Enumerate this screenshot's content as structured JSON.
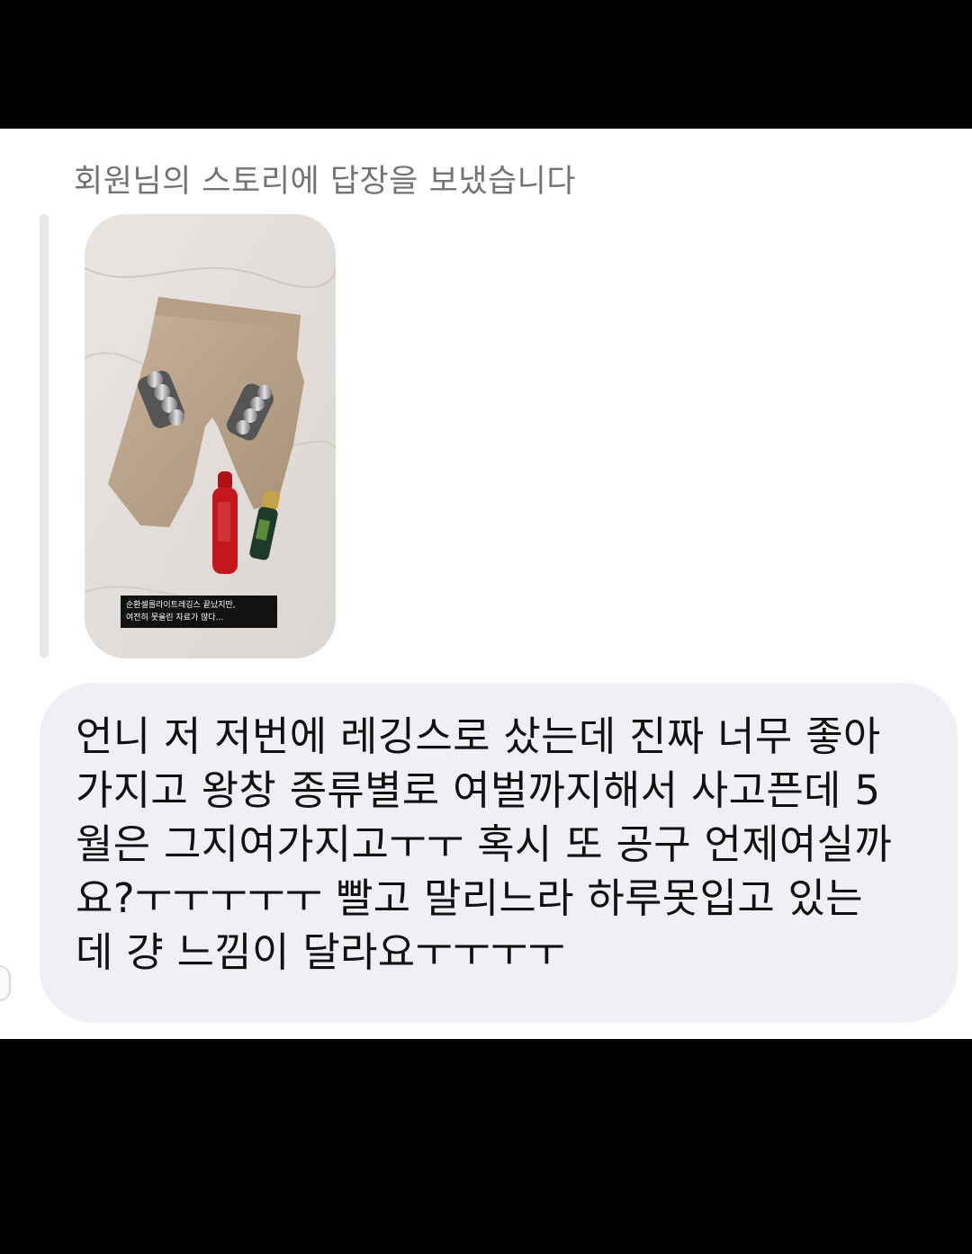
{
  "thread": {
    "story_reply_caption": "회원님의 스토리에 답장을 보냈습니다",
    "story": {
      "caption_lines": [
        "순환셀룰라이트레깅스 끝났지만,",
        "여전히 못올린 자료가 많다..."
      ]
    },
    "message": {
      "text": "언니 저 저번에 레깅스로 샀는데 진짜 너무 좋아\n가지고 왕창 종류별로 여벌까지해서 사고픈데 5\n월은 그지여가지고ㅜㅜ 혹시 또 공구 언제여실까\n요?ㅜㅜㅜㅜㅜ 빨고 말리느라 하루못입고 있는\n데 걍 느낌이 달라요ㅜㅜㅜㅜ"
    }
  },
  "colors": {
    "background": "#ffffff",
    "letterbox": "#000000",
    "caption_text": "#737373",
    "bubble": "#eff0f3",
    "message_text": "#111111"
  }
}
